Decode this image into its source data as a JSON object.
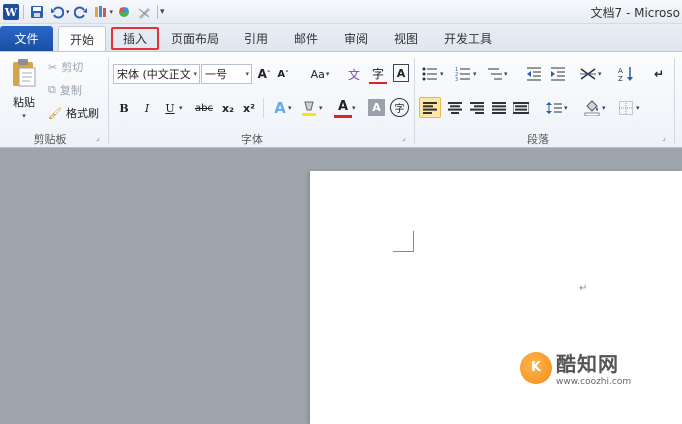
{
  "window": {
    "title": "文档7 - Microso"
  },
  "qat": {
    "logo_letter": "W"
  },
  "tabs": {
    "file": "文件",
    "items": [
      "开始",
      "插入",
      "页面布局",
      "引用",
      "邮件",
      "审阅",
      "视图",
      "开发工具"
    ],
    "active_index": 0,
    "highlighted_index": 1
  },
  "clipboard": {
    "paste": "粘贴",
    "cut": "剪切",
    "copy": "复制",
    "format_painter": "格式刷",
    "label": "剪贴板"
  },
  "font": {
    "family_value": "宋体 (中文正文",
    "size_value": "一号",
    "label": "字体",
    "grow": "A",
    "shrink": "A",
    "case": "Aa",
    "bold": "B",
    "italic": "I",
    "underline": "U",
    "strike": "abc",
    "subscript": "x₂",
    "superscript": "x²",
    "clear_format_char": "A",
    "phonetic_char": "A",
    "font_color_char": "A",
    "shade_char": "A",
    "enclose_char": "字",
    "pinyin_char": "文"
  },
  "paragraph": {
    "label": "段落"
  },
  "document": {
    "para_mark": "↵"
  },
  "watermark": {
    "logo": "K",
    "name": "酷知网",
    "url": "www.coozhi.com"
  },
  "colors": {
    "accent": "#2b67c7",
    "highlight_border": "#e0343a",
    "font_color": "#d22"
  }
}
